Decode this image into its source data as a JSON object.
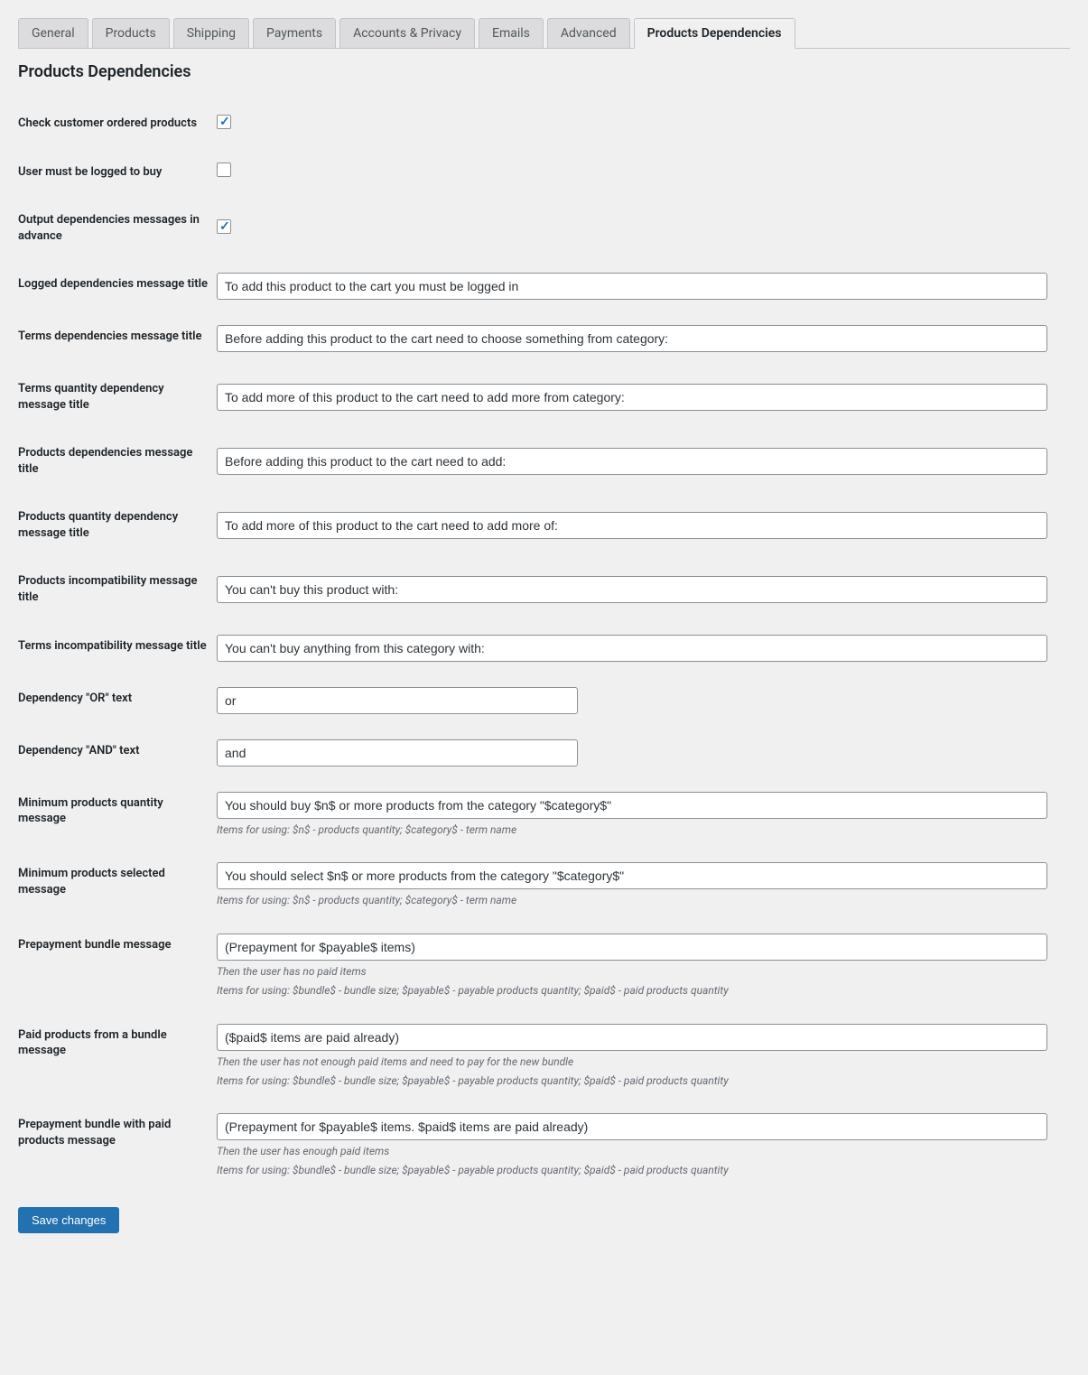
{
  "tabs": {
    "general": "General",
    "products": "Products",
    "shipping": "Shipping",
    "payments": "Payments",
    "accounts": "Accounts & Privacy",
    "emails": "Emails",
    "advanced": "Advanced",
    "dependencies": "Products Dependencies"
  },
  "section_title": "Products Dependencies",
  "labels": {
    "check_ordered": "Check customer ordered products",
    "must_logged": "User must be logged to buy",
    "output_adv": "Output dependencies messages in advance",
    "logged_title": "Logged dependencies message title",
    "terms_title": "Terms dependencies message title",
    "terms_qty_title": "Terms quantity dependency message title",
    "products_title": "Products dependencies message title",
    "products_qty_title": "Products quantity dependency message title",
    "products_incompat": "Products incompatibility message title",
    "terms_incompat": "Terms incompatibility message title",
    "or_text": "Dependency \"OR\" text",
    "and_text": "Dependency \"AND\" text",
    "min_qty_msg": "Minimum products quantity message",
    "min_sel_msg": "Minimum products selected message",
    "prepay_bundle": "Prepayment bundle message",
    "paid_bundle": "Paid products from a bundle message",
    "prepay_paid_bundle": "Prepayment bundle with paid products message"
  },
  "values": {
    "check_ordered": true,
    "must_logged": false,
    "output_adv": true,
    "logged_title": "To add this product to the cart you must be logged in",
    "terms_title": "Before adding this product to the cart need to choose something from category:",
    "terms_qty_title": "To add more of this product to the cart need to add more from category:",
    "products_title": "Before adding this product to the cart need to add:",
    "products_qty_title": "To add more of this product to the cart need to add more of:",
    "products_incompat": "You can't buy this product with:",
    "terms_incompat": "You can't buy anything from this category with:",
    "or_text": "or",
    "and_text": "and",
    "min_qty_msg": "You should buy $n$ or more products from the category \"$category$\"",
    "min_sel_msg": "You should select $n$ or more products from the category \"$category$\"",
    "prepay_bundle": "(Prepayment for $payable$ items)",
    "paid_bundle": "($paid$ items are paid already)",
    "prepay_paid_bundle": "(Prepayment for $payable$ items. $paid$ items are paid already)"
  },
  "desc": {
    "min_qty_msg": "Items for using: $n$ - products quantity; $category$ - term name",
    "min_sel_msg": "Items for using: $n$ - products quantity; $category$ - term name",
    "prepay_bundle_1": "Then the user has no paid items",
    "prepay_bundle_2": "Items for using: $bundle$ - bundle size; $payable$ - payable products quantity; $paid$ - paid products quantity",
    "paid_bundle_1": "Then the user has not enough paid items and need to pay for the new bundle",
    "paid_bundle_2": "Items for using: $bundle$ - bundle size; $payable$ - payable products quantity; $paid$ - paid products quantity",
    "prepay_paid_1": "Then the user has enough paid items",
    "prepay_paid_2": "Items for using: $bundle$ - bundle size; $payable$ - payable products quantity; $paid$ - paid products quantity"
  },
  "buttons": {
    "save": "Save changes"
  }
}
